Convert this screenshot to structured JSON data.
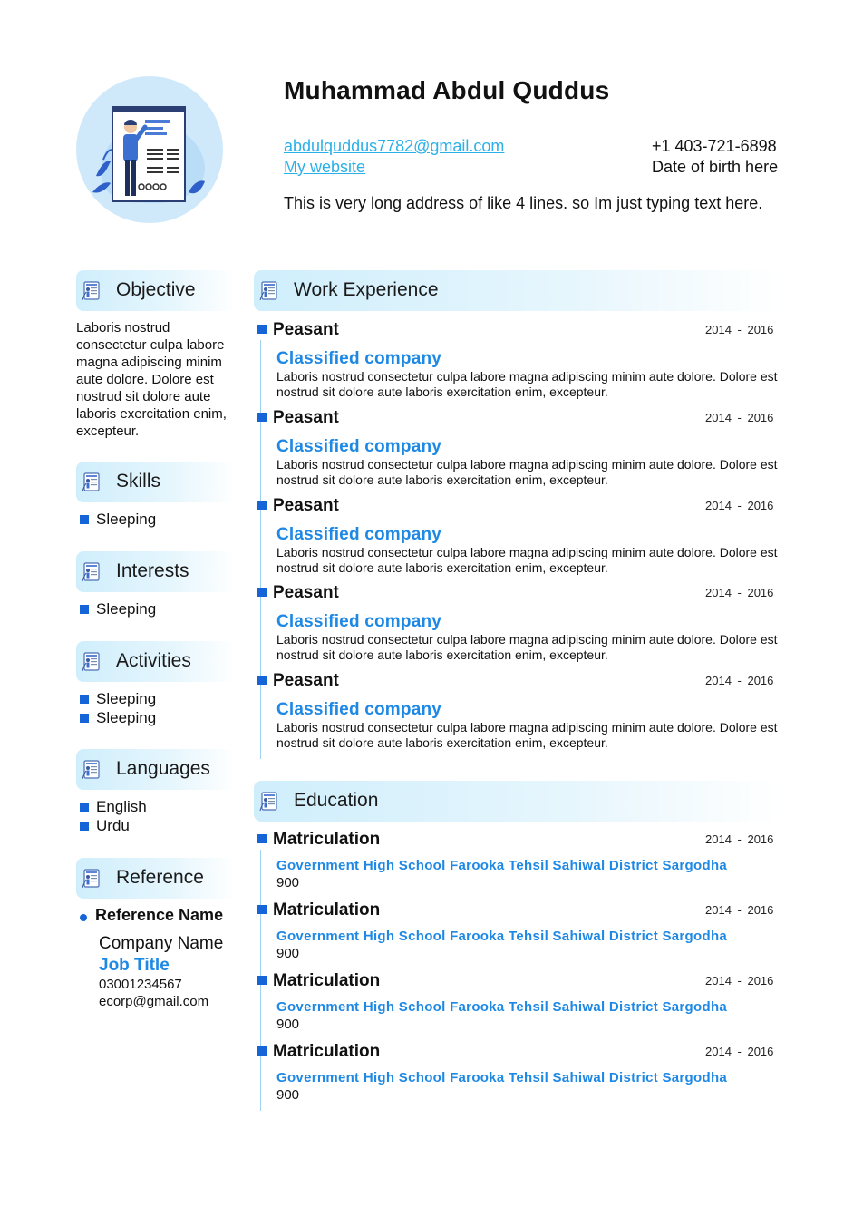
{
  "header": {
    "name": "Muhammad Abdul Quddus",
    "email": "abdulquddus7782@gmail.com",
    "website": "My website",
    "phone": "+1 403-721-6898",
    "dob": "Date of birth here",
    "address": "This is very long address of like 4 lines. so Im just typing text here."
  },
  "sections": {
    "objective": "Objective",
    "skills": "Skills",
    "interests": "Interests",
    "activities": "Activities",
    "languages": "Languages",
    "reference": "Reference",
    "work": "Work Experience",
    "education": "Education"
  },
  "objective_text": "Laboris nostrud consectetur culpa labore magna adipiscing minim aute dolore. Dolore est nostrud sit dolore aute laboris exercitation enim, excepteur.",
  "skills": [
    "Sleeping"
  ],
  "interests": [
    "Sleeping"
  ],
  "activities": [
    "Sleeping",
    "Sleeping"
  ],
  "languages": [
    "English",
    "Urdu"
  ],
  "reference": {
    "name": "Reference Name",
    "company": "Company Name",
    "job_title": "Job Title",
    "phone": "03001234567",
    "email": "ecorp@gmail.com"
  },
  "work": [
    {
      "title": "Peasant",
      "date": "2014 - 2016",
      "company": "Classified company",
      "desc": "Laboris nostrud consectetur culpa labore magna adipiscing minim aute dolore. Dolore est nostrud sit dolore aute laboris exercitation enim, excepteur."
    },
    {
      "title": "Peasant",
      "date": "2014 - 2016",
      "company": "Classified company",
      "desc": "Laboris nostrud consectetur culpa labore magna adipiscing minim aute dolore. Dolore est nostrud sit dolore aute laboris exercitation enim, excepteur."
    },
    {
      "title": "Peasant",
      "date": "2014 - 2016",
      "company": "Classified company",
      "desc": "Laboris nostrud consectetur culpa labore magna adipiscing minim aute dolore. Dolore est nostrud sit dolore aute laboris exercitation enim, excepteur."
    },
    {
      "title": "Peasant",
      "date": "2014 - 2016",
      "company": "Classified company",
      "desc": "Laboris nostrud consectetur culpa labore magna adipiscing minim aute dolore. Dolore est nostrud sit dolore aute laboris exercitation enim, excepteur."
    },
    {
      "title": "Peasant",
      "date": "2014 - 2016",
      "company": "Classified company",
      "desc": "Laboris nostrud consectetur culpa labore magna adipiscing minim aute dolore. Dolore est nostrud sit dolore aute laboris exercitation enim, excepteur."
    }
  ],
  "education": [
    {
      "title": "Matriculation",
      "date": "2014 - 2016",
      "school": "Government High School Farooka Tehsil Sahiwal District Sargodha",
      "grade": "900"
    },
    {
      "title": "Matriculation",
      "date": "2014 - 2016",
      "school": "Government High School Farooka Tehsil Sahiwal District Sargodha",
      "grade": "900"
    },
    {
      "title": "Matriculation",
      "date": "2014 - 2016",
      "school": "Government High School Farooka Tehsil Sahiwal District Sargodha",
      "grade": "900"
    },
    {
      "title": "Matriculation",
      "date": "2014 - 2016",
      "school": "Government High School Farooka Tehsil Sahiwal District Sargodha",
      "grade": "900"
    }
  ],
  "colors": {
    "accent": "#1565d8",
    "company": "#1e88e5",
    "link": "#2bb0e8",
    "header_bg": "#cfeefc"
  },
  "icons": {
    "avatar": "resume-illustration-icon",
    "section": "resume-document-icon"
  }
}
